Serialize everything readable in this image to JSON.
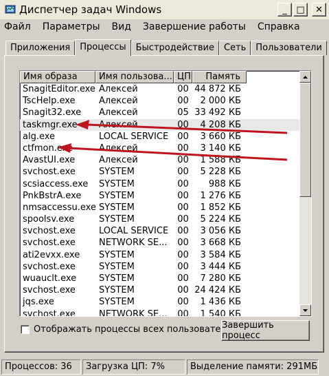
{
  "window": {
    "title": "Диспетчер задач Windows",
    "buttons": {
      "minimize": "_",
      "maximize": "□",
      "close": "✕"
    }
  },
  "menu": [
    "Файл",
    "Параметры",
    "Вид",
    "Завершение работы",
    "Справка"
  ],
  "tabs": [
    "Приложения",
    "Процессы",
    "Быстродействие",
    "Сеть",
    "Пользователи"
  ],
  "active_tab": "Процессы",
  "columns": [
    "Имя образа",
    "Имя пользова...",
    "ЦП",
    "Память"
  ],
  "rows": [
    {
      "name": "SnagitEditor.exe",
      "user": "Алексей",
      "cpu": "00",
      "mem": "44 872 КБ"
    },
    {
      "name": "TscHelp.exe",
      "user": "Алексей",
      "cpu": "00",
      "mem": "2 000 КБ"
    },
    {
      "name": "Snagit32.exe",
      "user": "Алексей",
      "cpu": "05",
      "mem": "33 492 КБ"
    },
    {
      "name": "taskmgr.exe",
      "user": "Алексей",
      "cpu": "00",
      "mem": "4 208 КБ"
    },
    {
      "name": "alg.exe",
      "user": "LOCAL SERVICE",
      "cpu": "00",
      "mem": "3 660 КБ"
    },
    {
      "name": "ctfmon.exe",
      "user": "Алексей",
      "cpu": "00",
      "mem": "3 140 КБ"
    },
    {
      "name": "AvastUI.exe",
      "user": "Алексей",
      "cpu": "00",
      "mem": "1 588 КБ"
    },
    {
      "name": "svchost.exe",
      "user": "SYSTEM",
      "cpu": "00",
      "mem": "5 228 КБ"
    },
    {
      "name": "scsiaccess.exe",
      "user": "SYSTEM",
      "cpu": "00",
      "mem": "988 КБ"
    },
    {
      "name": "PnkBstrA.exe",
      "user": "SYSTEM",
      "cpu": "00",
      "mem": "1 276 КБ"
    },
    {
      "name": "nmsaccessu.exe",
      "user": "SYSTEM",
      "cpu": "00",
      "mem": "1 852 КБ"
    },
    {
      "name": "spoolsv.exe",
      "user": "SYSTEM",
      "cpu": "00",
      "mem": "5 224 КБ"
    },
    {
      "name": "svchost.exe",
      "user": "LOCAL SERVICE",
      "cpu": "00",
      "mem": "3 056 КБ"
    },
    {
      "name": "svchost.exe",
      "user": "NETWORK SE...",
      "cpu": "00",
      "mem": "3 668 КБ"
    },
    {
      "name": "ati2evxx.exe",
      "user": "SYSTEM",
      "cpu": "00",
      "mem": "3 584 КБ"
    },
    {
      "name": "svchost.exe",
      "user": "SYSTEM",
      "cpu": "00",
      "mem": "3 444 КБ"
    },
    {
      "name": "wuauclt.exe",
      "user": "SYSTEM",
      "cpu": "00",
      "mem": "7 280 КБ"
    },
    {
      "name": "svchost.exe",
      "user": "SYSTEM",
      "cpu": "00",
      "mem": "24 424 КБ"
    },
    {
      "name": "jqs.exe",
      "user": "SYSTEM",
      "cpu": "00",
      "mem": "1 436 КБ"
    },
    {
      "name": "svchost.exe",
      "user": "NETWORK SE...",
      "cpu": "00",
      "mem": "1 540 КБ"
    }
  ],
  "show_all_users_label": "Отображать процессы всех пользователей",
  "end_process_label": "Завершить процесс",
  "status": {
    "processes": "Процессов: 36",
    "cpu": "Загрузка ЦП: 7%",
    "memory": "Выделение памяти: 291МБ"
  },
  "colors": {
    "arrow": "#c0141c",
    "window_bg": "#d4d0c8",
    "list_bg": "#ffffff"
  }
}
